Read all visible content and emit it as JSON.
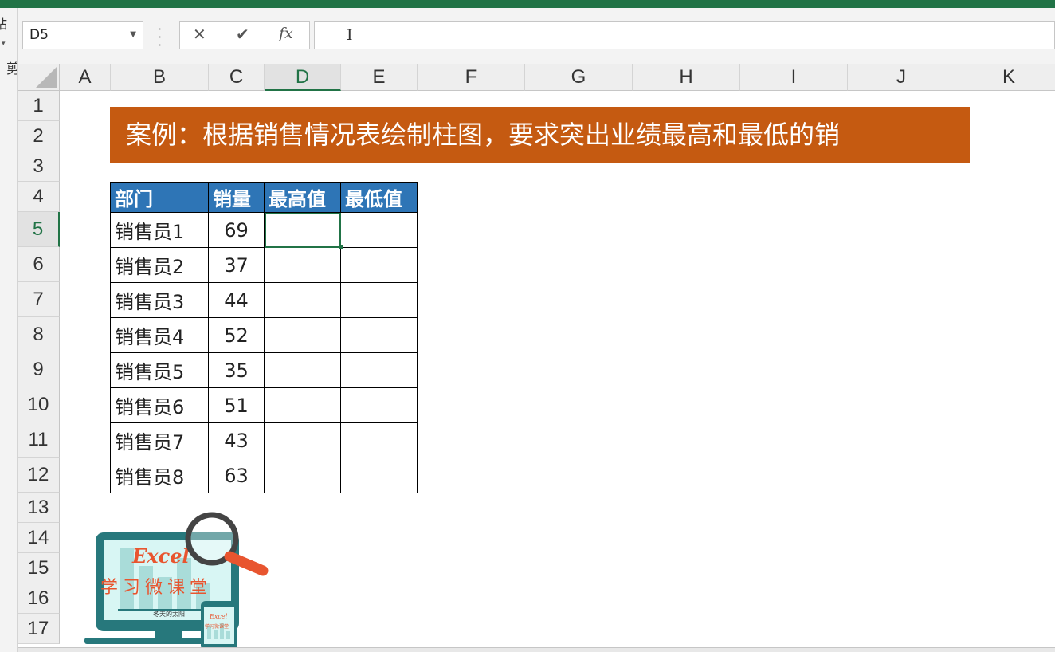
{
  "name_box": {
    "value": "D5"
  },
  "formula_bar": {
    "cancel_icon": "✕",
    "enter_icon": "✔",
    "fx_label": "fx",
    "value": ""
  },
  "ribbon_fragments": {
    "paste": "贴",
    "cut": "剪"
  },
  "columns": [
    "A",
    "B",
    "C",
    "D",
    "E",
    "F",
    "G",
    "H",
    "I",
    "J",
    "K"
  ],
  "selected_column": "D",
  "rows": [
    "1",
    "2",
    "3",
    "4",
    "5",
    "6",
    "7",
    "8",
    "9",
    "10",
    "11",
    "12",
    "13",
    "14",
    "15",
    "16",
    "17"
  ],
  "selected_row": "5",
  "banner": {
    "text": "案例：根据销售情况表绘制柱图，要求突出业绩最高和最低的销"
  },
  "table": {
    "headers": [
      "部门",
      "销量",
      "最高值",
      "最低值"
    ],
    "rows": [
      [
        "销售员1",
        "69",
        "",
        ""
      ],
      [
        "销售员2",
        "37",
        "",
        ""
      ],
      [
        "销售员3",
        "44",
        "",
        ""
      ],
      [
        "销售员4",
        "52",
        "",
        ""
      ],
      [
        "销售员5",
        "35",
        "",
        ""
      ],
      [
        "销售员6",
        "51",
        "",
        ""
      ],
      [
        "销售员7",
        "43",
        "",
        ""
      ],
      [
        "销售员8",
        "63",
        "",
        ""
      ]
    ]
  },
  "logo": {
    "brand": "Excel",
    "name": "学习微课堂",
    "tagline": "冬天的太阳",
    "small_brand": "Excel",
    "small_name": "学习微课堂"
  },
  "colors": {
    "excel_green": "#217346",
    "banner": "#c55a11",
    "table_header": "#2e75b6",
    "logo_teal": "#27787c"
  }
}
